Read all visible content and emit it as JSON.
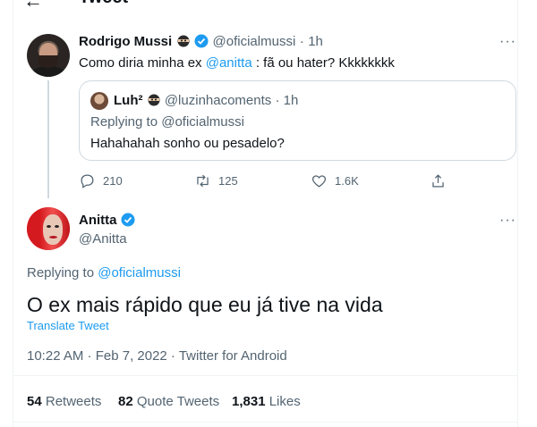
{
  "header": {
    "title": "Tweet"
  },
  "parent_tweet": {
    "author_name": "Rodrigo Mussi",
    "handle": "@oficialmussi",
    "separator": "·",
    "time": "1h",
    "text_before": "Como diria minha ex ",
    "mention": "@anitta",
    "text_after": " : fã ou hater? Kkkkkkkk",
    "quote": {
      "author_name": "Luh²",
      "handle": "@luzinhacoments",
      "separator": "·",
      "time": "1h",
      "replying_label": "Replying to ",
      "replying_handle": "@oficialmussi",
      "text": "Hahahahah sonho ou pesadelo?"
    },
    "actions": {
      "replies": "210",
      "retweets": "125",
      "likes": "1.6K"
    }
  },
  "main_tweet": {
    "author_name": "Anitta",
    "handle": "@Anitta",
    "replying_label": "Replying to ",
    "replying_handle": "@oficialmussi",
    "text": "O ex mais rápido que eu já tive na vida",
    "translate": "Translate Tweet",
    "meta": "10:22 AM · Feb 7, 2022 · Twitter for Android",
    "stats": {
      "retweets_count": "54",
      "retweets_label": " Retweets",
      "quotes_count": "82",
      "quotes_label": " Quote Tweets",
      "likes_count": "1,831",
      "likes_label": " Likes"
    }
  },
  "colors": {
    "accent": "#1d9bf0",
    "muted": "#536471",
    "text": "#0f1419",
    "border": "#eff3f4"
  }
}
